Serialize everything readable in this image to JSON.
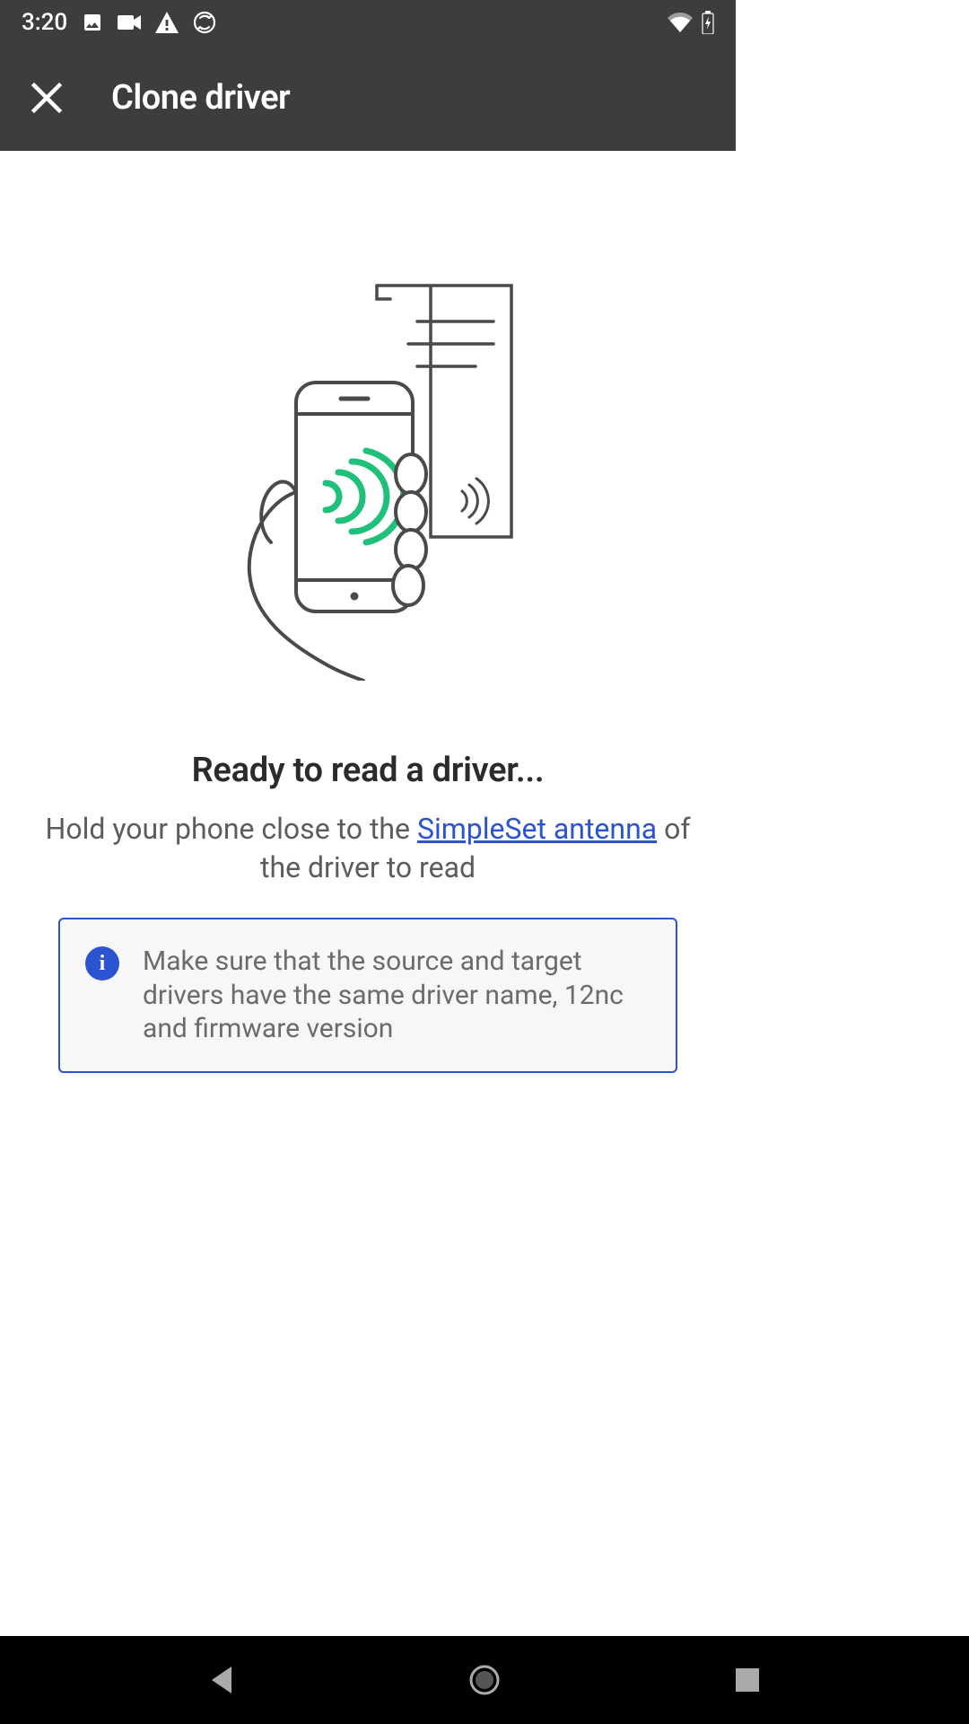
{
  "status": {
    "time": "3:20"
  },
  "header": {
    "title": "Clone driver"
  },
  "main": {
    "ready_title": "Ready to read a driver...",
    "instruction_pre": "Hold your phone close to the ",
    "instruction_link": "SimpleSet antenna",
    "instruction_post": " of the driver to read",
    "info_text": "Make sure that the source and target drivers have the same driver name, 12nc and firmware version"
  }
}
